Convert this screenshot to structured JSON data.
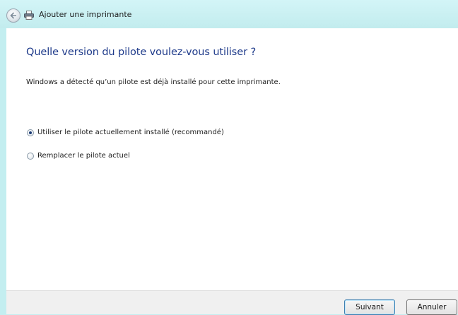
{
  "window": {
    "title": "Ajouter une imprimante",
    "back_icon": "back-arrow-icon",
    "printer_icon": "printer-icon"
  },
  "main": {
    "heading": "Quelle version du pilote voulez-vous utiliser ?",
    "description": "Windows a détecté qu’un pilote est déjà installé pour cette imprimante.",
    "options": [
      {
        "label": "Utiliser le pilote actuellement installé (recommandé)",
        "checked": true
      },
      {
        "label": "Remplacer le pilote actuel",
        "checked": false
      }
    ]
  },
  "footer": {
    "next_label": "Suivant",
    "cancel_label": "Annuler"
  },
  "colors": {
    "frame": "#c3eef0",
    "heading": "#1e3a8a",
    "footer": "#f0f0f0"
  }
}
